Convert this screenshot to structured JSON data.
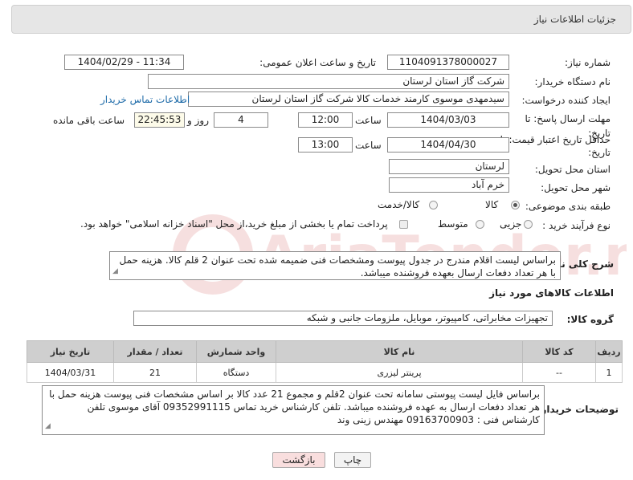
{
  "header": {
    "title": "جزئیات اطلاعات نیاز"
  },
  "fields": {
    "need_number_label": "شماره نیاز:",
    "need_number": "1104091378000027",
    "announce_label": "تاریخ و ساعت اعلان عمومی:",
    "announce_value": "1404/02/29 - 11:34",
    "buyer_org_label": "نام دستگاه خریدار:",
    "buyer_org": "شرکت گاز استان لرستان",
    "requester_label": "ایجاد کننده درخواست:",
    "requester": "سیدمهدی موسوی کارمند خدمات کالا شرکت گاز استان لرستان",
    "buyer_contact_link": "اطلاعات تماس خریدار",
    "deadline_label": "مهلت ارسال پاسخ: تا تاریخ:",
    "deadline_date": "1404/03/03",
    "time_label": "ساعت",
    "deadline_time": "12:00",
    "days_value": "4",
    "days_label": "روز و",
    "remaining_time": "22:45:53",
    "remaining_label": "ساعت باقی مانده",
    "price_validity_label": "حداقل تاریخ اعتبار قیمت: تا تاریخ:",
    "price_validity_date": "1404/04/30",
    "price_validity_time": "13:00",
    "province_label": "استان محل تحویل:",
    "province": "لرستان",
    "city_label": "شهر محل تحویل:",
    "city": "خرم آباد",
    "category_label": "طبقه بندی موضوعی:",
    "category_options": [
      "کالا",
      "کالا/خدمت"
    ],
    "process_label": "نوع فرآیند خرید :",
    "process_options": [
      "جزیی",
      "متوسط"
    ],
    "payment_note": "پرداخت تمام یا بخشی از مبلغ خرید،از محل \"اسناد خزانه اسلامی\" خواهد بود."
  },
  "description": {
    "label": "شرح کلی نیاز:",
    "text": "براساس لیست اقلام مندرج در جدول پیوست ومشخصات فنی ضمیمه شده تحت عنوان 2 قلم کالا. هزینه حمل با هر تعداد دفعات ارسال بعهده فروشنده میباشد."
  },
  "goods_section": {
    "title": "اطلاعات کالاهای مورد نیاز",
    "group_label": "گروه کالا:",
    "group_value": "تجهیزات مخابراتی، کامپیوتر، موبایل، ملزومات جانبی و شبکه"
  },
  "table": {
    "headers": [
      "ردیف",
      "کد کالا",
      "نام کالا",
      "واحد شمارش",
      "تعداد / مقدار",
      "تاریخ نیاز"
    ],
    "rows": [
      [
        "1",
        "--",
        "پرینتر لیزری",
        "دستگاه",
        "21",
        "1404/03/31"
      ]
    ]
  },
  "buyer_notes": {
    "label": "توضیحات خریدار:",
    "text": "براساس  فایل لیست پیوستی سامانه تحت عنوان 2قلم و مجموع 21 عدد کالا بر اساس مشخصات فنی پیوست هزینه حمل با هر تعداد دفعات ارسال به عهده فروشنده میباشد. تلفن کارشناس خرید تماس 09352991115 آقای موسوی تلفن کارشناس فنی : 09163700903 مهندس زینی وند"
  },
  "buttons": {
    "print": "چاپ",
    "back": "بازگشت"
  },
  "watermark": {
    "text": "AriaTender.neT"
  },
  "colors": {
    "header_bg": "#e6e6e6",
    "link": "#1c6aa8",
    "back_btn_bg": "#f9dede",
    "table_header_bg": "#cfcfcf"
  }
}
